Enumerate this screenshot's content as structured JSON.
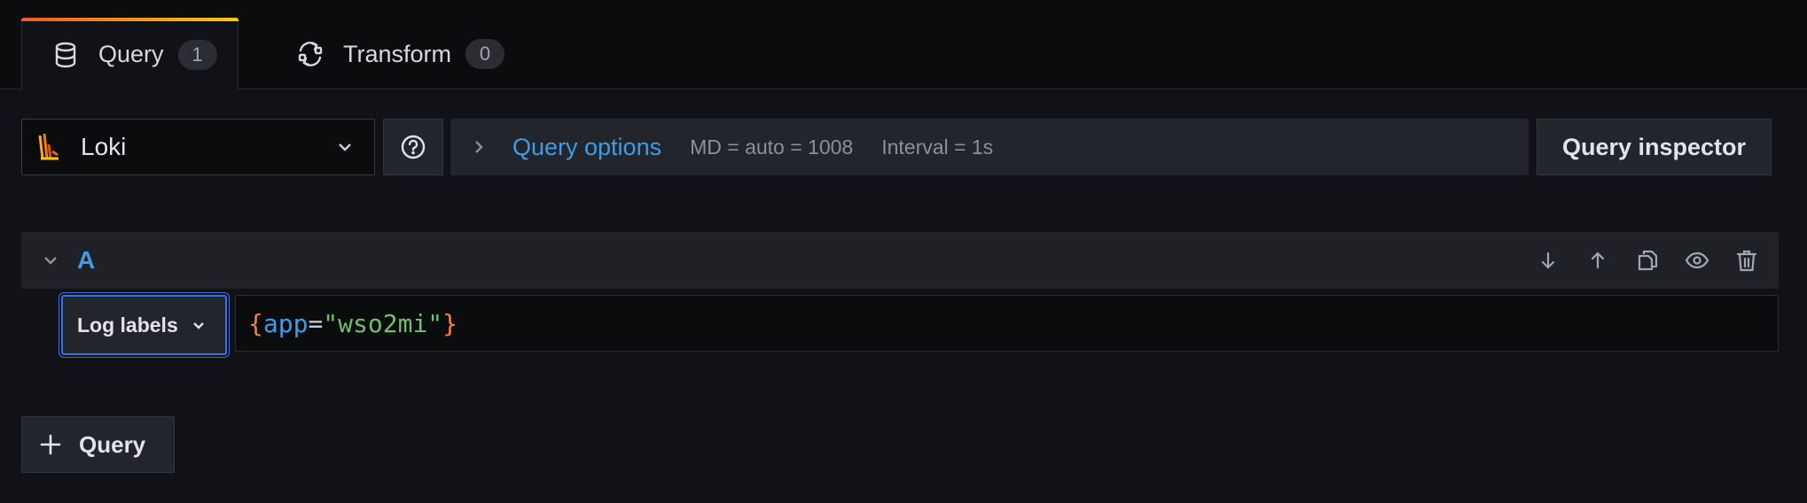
{
  "tabs": [
    {
      "label": "Query",
      "count": "1",
      "icon": "database-icon"
    },
    {
      "label": "Transform",
      "count": "0",
      "icon": "transform-icon"
    }
  ],
  "datasource": {
    "name": "Loki",
    "icon": "loki-logo"
  },
  "help": {
    "icon": "question-circle-icon"
  },
  "query_options": {
    "title": "Query options",
    "md": "MD = auto = 1008",
    "interval": "Interval = 1s"
  },
  "inspector": {
    "label": "Query inspector"
  },
  "query_row": {
    "ref_id": "A",
    "actions": [
      "move-down-icon",
      "move-up-icon",
      "duplicate-icon",
      "eye-icon",
      "trash-icon"
    ],
    "label_button": "Log labels",
    "expr": {
      "open": "{",
      "key": "app",
      "eq": "=",
      "value": "\"wso2mi\"",
      "close": "}"
    }
  },
  "add_query": {
    "label": "Query"
  },
  "colors": {
    "accent_blue": "#3d9de8",
    "brace": "#f2803e",
    "string": "#73bf69",
    "focus": "#3d71d9"
  }
}
